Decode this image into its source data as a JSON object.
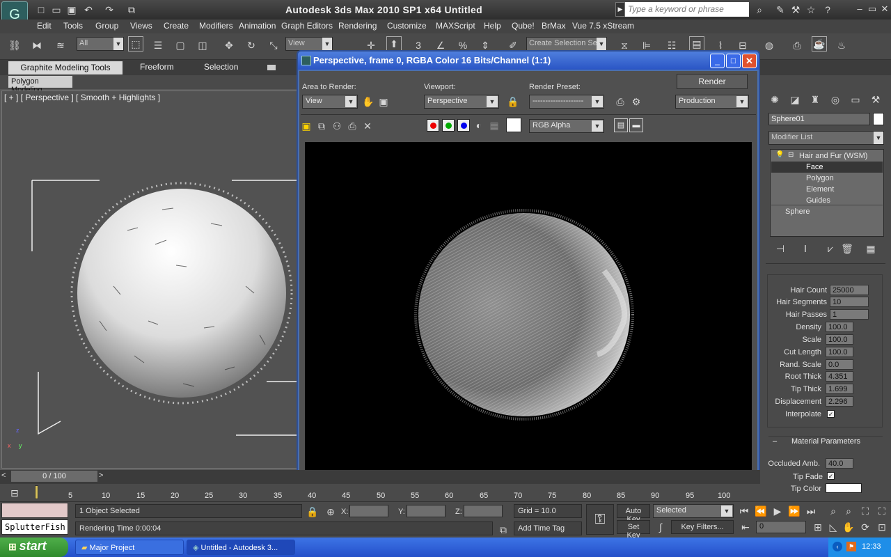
{
  "app": {
    "title": "Autodesk 3ds Max  2010 SP1 x64      Untitled",
    "search_placeholder": "Type a keyword or phrase",
    "logo_glyph": "G",
    "logo_icon": "3dsmax-logo-icon"
  },
  "menu": [
    "Edit",
    "Tools",
    "Group",
    "Views",
    "Create",
    "Modifiers",
    "Animation",
    "Graph Editors",
    "Rendering",
    "Customize",
    "MAXScript",
    "Help",
    "Qube!",
    "BrMax",
    "Vue 7.5 xStream"
  ],
  "toolbar": {
    "selection_filter": "All",
    "ref_coord": "View",
    "named_selection": "Create Selection Se"
  },
  "ribbon": {
    "tabs": [
      "Graphite Modeling Tools",
      "Freeform",
      "Selection"
    ],
    "panel": "Polygon Modeling"
  },
  "viewport": {
    "label": "[ + ] [ Perspective ] [ Smooth + Highlights ]"
  },
  "render_window": {
    "title": "Perspective, frame 0, RGBA Color 16 Bits/Channel (1:1)",
    "area_label": "Area to Render:",
    "area_value": "View",
    "viewport_label": "Viewport:",
    "viewport_value": "Perspective",
    "preset_label": "Render Preset:",
    "preset_value": "--------------------",
    "render_button": "Render",
    "production": "Production",
    "channel": "RGB Alpha"
  },
  "command_panel": {
    "object_name": "Sphere01",
    "modifier_list": "Modifier List",
    "stack": [
      "Hair and Fur (WSM)",
      "Face",
      "Polygon",
      "Element",
      "Guides",
      "Sphere"
    ],
    "params": [
      {
        "label": "Hair Count",
        "value": "25000"
      },
      {
        "label": "Hair Segments",
        "value": "10"
      },
      {
        "label": "Hair Passes",
        "value": "1"
      },
      {
        "label": "Density",
        "value": "100.0"
      },
      {
        "label": "Scale",
        "value": "100.0"
      },
      {
        "label": "Cut Length",
        "value": "100.0"
      },
      {
        "label": "Rand. Scale",
        "value": "0.0"
      },
      {
        "label": "Root Thick",
        "value": "4.351"
      },
      {
        "label": "Tip Thick",
        "value": "1.699"
      },
      {
        "label": "Displacement",
        "value": "2.296"
      }
    ],
    "interpolate_label": "Interpolate",
    "material_rollout": "Material Parameters",
    "occluded_label": "Occluded Amb.",
    "occluded_value": "40.0",
    "tip_fade_label": "Tip Fade",
    "tip_color_label": "Tip Color"
  },
  "timeline": {
    "slider": "0 / 100",
    "ticks": [
      "5",
      "10",
      "15",
      "20",
      "25",
      "30",
      "35",
      "40",
      "45",
      "50",
      "55",
      "60",
      "65",
      "70",
      "75",
      "80",
      "85",
      "90",
      "95",
      "100"
    ]
  },
  "status": {
    "selection": "1 Object Selected",
    "render_time": "Rendering Time  0:00:04",
    "x_label": "X:",
    "y_label": "Y:",
    "z_label": "Z:",
    "grid": "Grid = 10.0",
    "add_time_tag": "Add Time Tag",
    "auto_key": "Auto Key",
    "selected": "Selected",
    "set_key": "Set Key",
    "key_filters": "Key Filters...",
    "frame": "0",
    "listener": "SplutterFish"
  },
  "taskbar": {
    "start": "start",
    "tasks": [
      "Major Project",
      "Untitled - Autodesk 3..."
    ],
    "clock": "12:33"
  }
}
